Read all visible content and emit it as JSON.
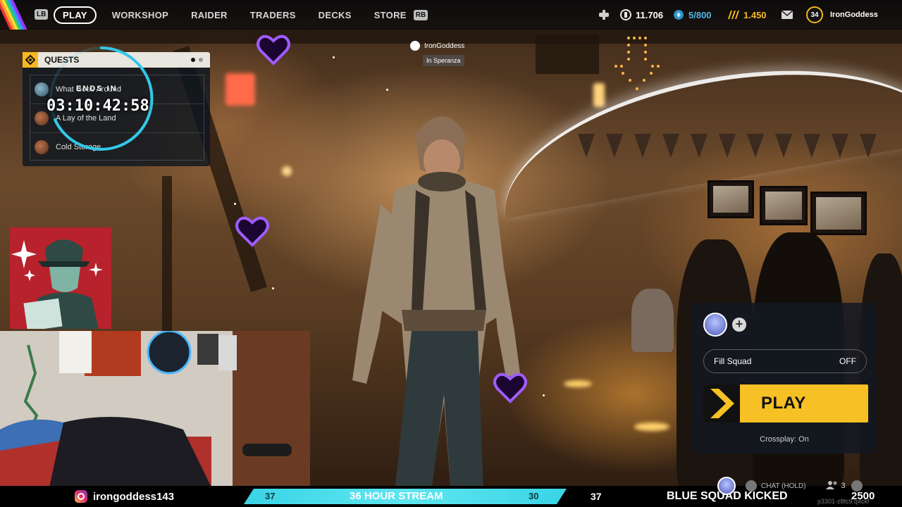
{
  "nav": {
    "lb": "LB",
    "rb": "RB",
    "items": [
      "PLAY",
      "WORKSHOP",
      "RAIDER",
      "TRADERS",
      "DECKS",
      "STORE"
    ],
    "active": "PLAY"
  },
  "currencies": {
    "coins": "11.706",
    "tokens": "5/800",
    "credits": "1.450"
  },
  "profile": {
    "level": "34",
    "username": "IronGoddess"
  },
  "quests": {
    "title": "QUESTS",
    "items": [
      "What Goes Around",
      "A Lay of the Land",
      "Cold Storage"
    ],
    "ends_label": "ENDS IN",
    "ends_time": "03:10:42:58"
  },
  "player_tag": {
    "name": "IronGoddess",
    "location": "In Speranza"
  },
  "play_panel": {
    "fill_squad_label": "Fill Squad",
    "fill_squad_value": "OFF",
    "play_label": "PLAY",
    "crossplay": "Crossplay: On"
  },
  "stream": {
    "instagram": "irongoddess143",
    "left_number": "37",
    "title": "36 HOUR STREAM",
    "right_number": "30",
    "after_number": "37",
    "kicked_label": "BLUE SQUAD KICKED",
    "kicked_value": "2500"
  },
  "chat": {
    "label": "CHAT (HOLD)",
    "members": "3"
  },
  "build": "p3301-z8fc9 q4ckf",
  "colors": {
    "accent_yellow": "#f7c024",
    "timer_cyan": "#33c8e8",
    "stream_bar": "#3ad4e6",
    "heart_purple": "#8a3cff"
  }
}
